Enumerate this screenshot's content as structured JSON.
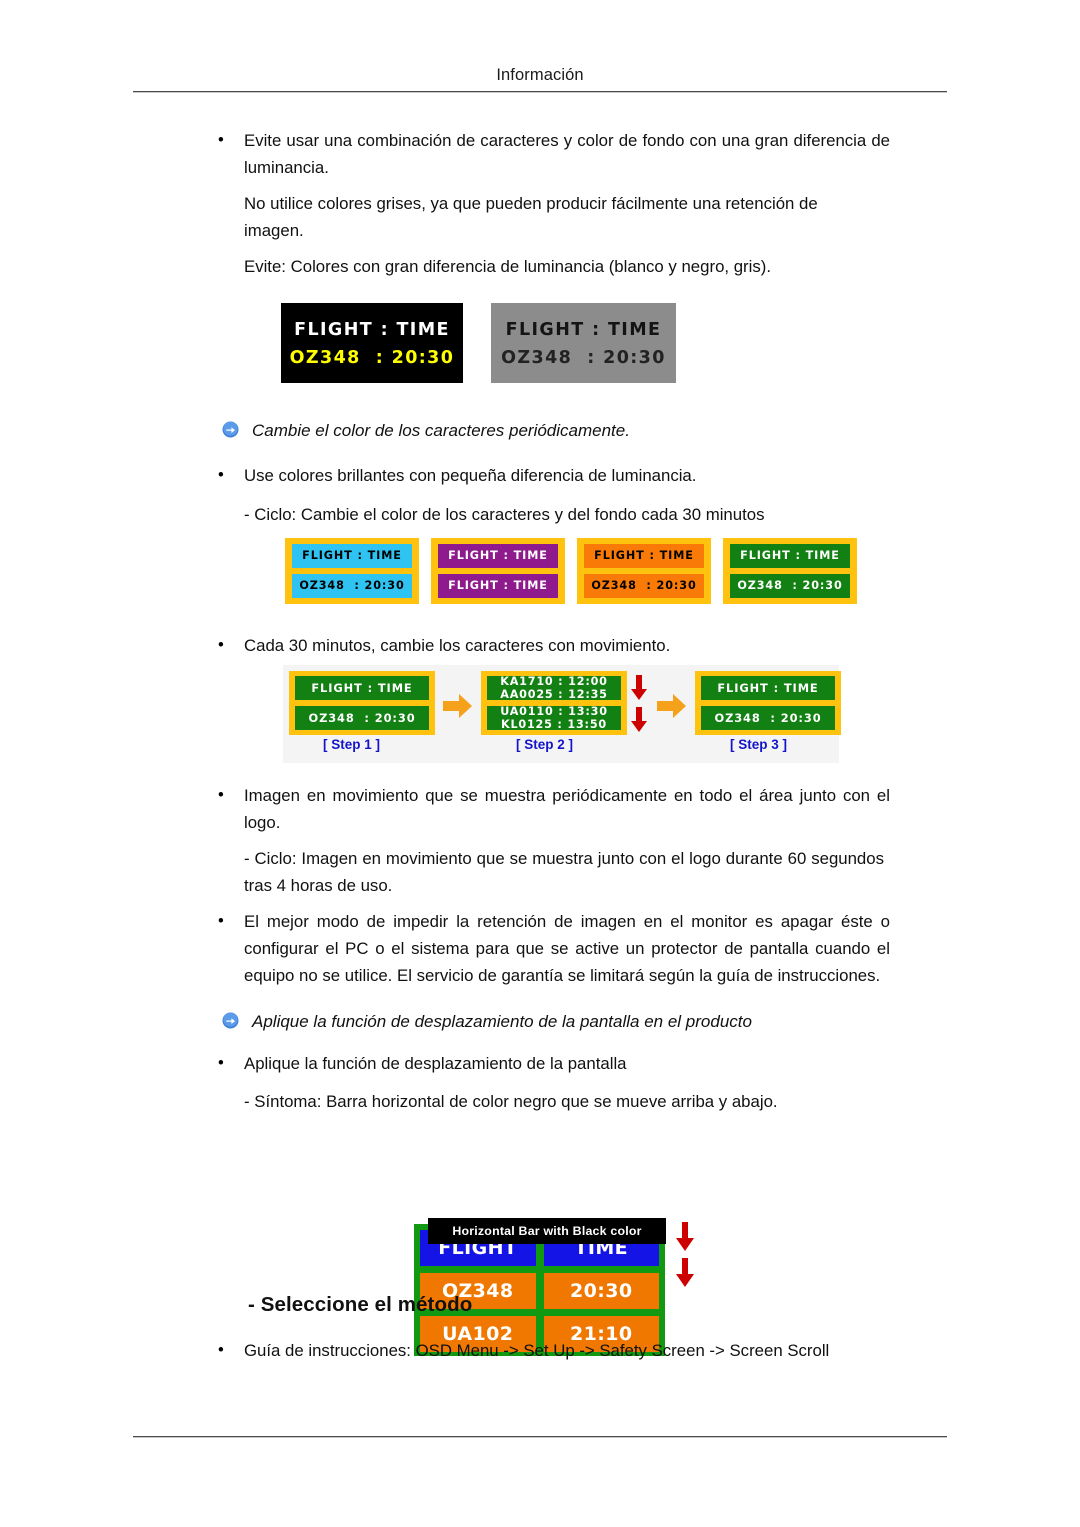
{
  "header": {
    "title": "Información"
  },
  "body": {
    "bullet1": "Evite usar una combinación de caracteres y color de fondo con una gran diferencia de luminancia.",
    "para1": "No utilice colores grises, ya que pueden producir fácilmente una retención de imagen.",
    "para2": "Evite: Colores con gran diferencia de luminancia (blanco y negro, gris).",
    "heading1": "Cambie el color de los caracteres periódicamente.",
    "bullet2": "Use colores brillantes con pequeña diferencia de luminancia.",
    "para3": "- Ciclo: Cambie el color de los caracteres y del fondo cada 30 minutos",
    "bullet3": "Cada 30 minutos, cambie los caracteres con movimiento.",
    "bullet4": "Imagen en movimiento que se muestra periódicamente en todo el área junto con el logo.",
    "para4": "- Ciclo: Imagen en movimiento que se muestra junto con el logo durante 60 segundos tras 4 horas de uso.",
    "bullet5": "El mejor modo de impedir la retención de imagen en el monitor es apagar éste o configurar el PC o el sistema para que se active un protector de pantalla cuando el equipo no se utilice. El servicio de garantía se limitará según la guía de instrucciones.",
    "heading2": "Aplique la función de desplazamiento de la pantalla en el producto",
    "bullet6": "Aplique la función de desplazamiento de la pantalla",
    "para5": "- Síntoma: Barra horizontal de color negro que se mueve arriba y abajo.",
    "section_heading": "- Seleccione el método",
    "bullet7": "Guía de instrucciones: OSD Menu -> Set Up -> Safety Screen -> Screen Scroll",
    "bullet_glyph": "•"
  },
  "figures": {
    "fig1": {
      "panels": [
        {
          "name": "black-panel",
          "background": "#000000",
          "line1": "FLIGHT : TIME",
          "line1_color": "#ffffff",
          "line2": "OZ348  : 20:30",
          "line2_color": "#ffff00"
        },
        {
          "name": "grey-panel",
          "background": "#8c8c8c",
          "line1": "FLIGHT : TIME",
          "line1_color": "#141414",
          "line2": "OZ348  : 20:30",
          "line2_color": "#222222"
        }
      ]
    },
    "fig2": {
      "border_color": "#ffc20e",
      "panels": [
        {
          "name": "cyan-panel",
          "background": "#2ec3f0",
          "text_color": "#000000",
          "row1": "FLIGHT : TIME",
          "row2": "OZ348  : 20:30"
        },
        {
          "name": "purple-panel",
          "background": "#8e1a8e",
          "text_color": "#ffffff",
          "row1": "FLIGHT : TIME",
          "row2": "FLIGHT : TIME"
        },
        {
          "name": "orange-panel",
          "background": "#f97a07",
          "text_color": "#000000",
          "row1": "FLIGHT : TIME",
          "row2": "OZ348  : 20:30"
        },
        {
          "name": "green-panel",
          "background": "#128012",
          "text_color": "#ffffff",
          "row1": "FLIGHT : TIME",
          "row2": "OZ348  : 20:30"
        }
      ]
    },
    "fig3": {
      "step1": {
        "label": "[ Step 1 ]",
        "row1": "FLIGHT : TIME",
        "row2": "OZ348  : 20:30"
      },
      "step2": {
        "label": "[ Step 2 ]",
        "row1_top": "KA1710 : 12:00",
        "row1_bottom": "AA0025 : 12:35",
        "row2_top": "UA0110 : 13:30",
        "row2_bottom": "KL0125 : 13:50"
      },
      "step3": {
        "label": "[ Step 3 ]",
        "row1": "FLIGHT : TIME",
        "row2": "OZ348  : 20:30"
      },
      "label_color": "#1414cc",
      "arrow_color": "#f5a11c",
      "scroll_arrow_color": "#cc0000"
    },
    "fig4": {
      "bar_caption": "Horizontal Bar with Black color",
      "rows": [
        {
          "left": "FLIGHT",
          "right": "TIME",
          "style": "blue"
        },
        {
          "left": "OZ348",
          "right": "20:30",
          "style": "orange"
        },
        {
          "left": "UA102",
          "right": "21:10",
          "style": "orange"
        }
      ],
      "frame_color": "#119911",
      "arrow_color": "#cc0000"
    }
  }
}
